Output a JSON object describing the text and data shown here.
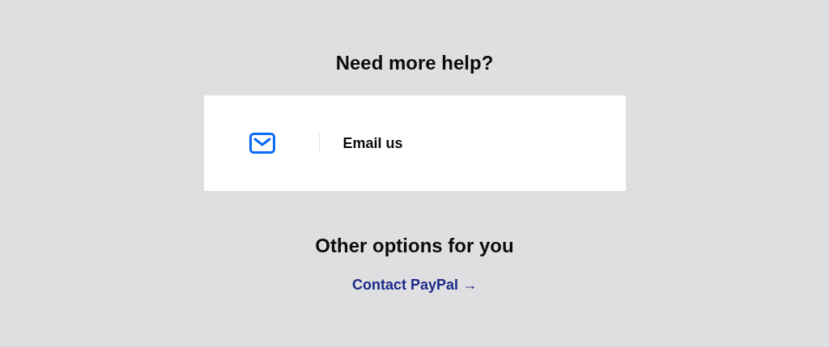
{
  "heading": "Need more help?",
  "contact_card": {
    "label": "Email us"
  },
  "other_heading": "Other options for you",
  "link": "Contact PayPal →"
}
